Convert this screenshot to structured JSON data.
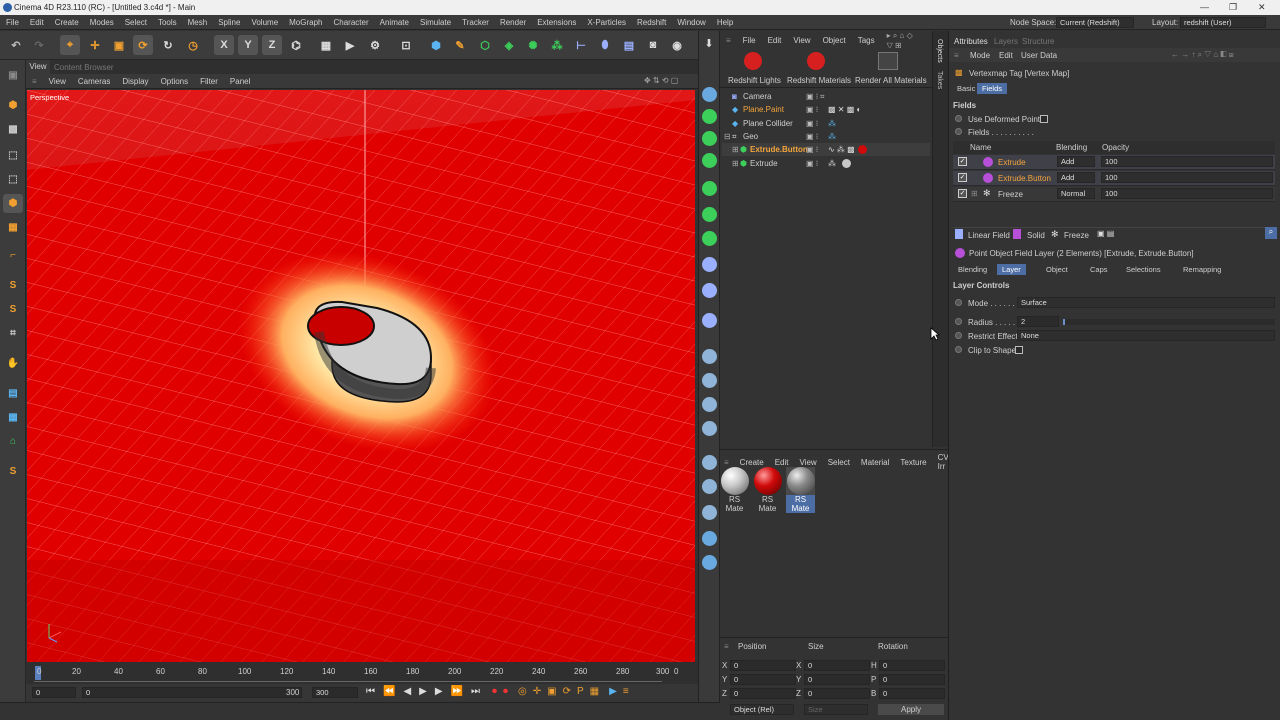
{
  "window": {
    "title": "Cinema 4D R23.110 (RC) - [Untitled 3.c4d *] - Main"
  },
  "menu": [
    "File",
    "Edit",
    "Create",
    "Modes",
    "Select",
    "Tools",
    "Mesh",
    "Spline",
    "Volume",
    "MoGraph",
    "Character",
    "Animate",
    "Simulate",
    "Tracker",
    "Render",
    "Extensions",
    "X-Particles",
    "Redshift",
    "Window",
    "Help"
  ],
  "node_space": {
    "label": "Node Space:",
    "value": "Current (Redshift)"
  },
  "layout": {
    "label": "Layout:",
    "value": "redshift (User)"
  },
  "viewport": {
    "tabs": [
      "View",
      "Content Browser"
    ],
    "menu": [
      "View",
      "Cameras",
      "Display",
      "Options",
      "Filter",
      "Panel"
    ],
    "label": "Perspective"
  },
  "timeline": {
    "ticks": [
      "0",
      "20",
      "40",
      "60",
      "80",
      "100",
      "120",
      "140",
      "160",
      "180",
      "200",
      "220",
      "240",
      "260",
      "280",
      "300"
    ],
    "end_frame": "0",
    "current": "0",
    "start": "0",
    "min_field": "300",
    "max_field": "300"
  },
  "objects": {
    "menu": [
      "File",
      "Edit",
      "View",
      "Object",
      "Tags"
    ],
    "rs_buttons": [
      "Redshift Lights",
      "Redshift Materials",
      "Render All Materials"
    ],
    "items": [
      {
        "name": "Camera",
        "indent": 0,
        "highlight": false
      },
      {
        "name": "Plane.Paint",
        "indent": 0,
        "highlight": true
      },
      {
        "name": "Plane Collider",
        "indent": 0,
        "highlight": false
      },
      {
        "name": "Geo",
        "indent": 0,
        "highlight": false
      },
      {
        "name": "Extrude.Button",
        "indent": 1,
        "highlight": true
      },
      {
        "name": "Extrude",
        "indent": 1,
        "highlight": false
      }
    ],
    "side_tabs": [
      "Objects",
      "Takes"
    ]
  },
  "materials": {
    "menu": [
      "Create",
      "Edit",
      "View",
      "Select",
      "Material",
      "Texture",
      "CV-Irr"
    ],
    "items": [
      {
        "label": "RS Mate",
        "color": "#c8c8c8"
      },
      {
        "label": "RS Mate",
        "color": "#d10a0a"
      },
      {
        "label": "RS Mate",
        "color": "#8a8a8a"
      }
    ]
  },
  "coordinates": {
    "headers": [
      "Position",
      "Size",
      "Rotation"
    ],
    "rows": [
      {
        "axis": "X",
        "pos": "0",
        "size_axis": "X",
        "size": "0",
        "rot_axis": "H",
        "rot": "0"
      },
      {
        "axis": "Y",
        "pos": "0",
        "size_axis": "Y",
        "size": "0",
        "rot_axis": "P",
        "rot": "0"
      },
      {
        "axis": "Z",
        "pos": "0",
        "size_axis": "Z",
        "size": "0",
        "rot_axis": "B",
        "rot": "0"
      }
    ],
    "mode": "Object (Rel)",
    "size_mode": "Size",
    "apply": "Apply"
  },
  "attributes": {
    "tabs": [
      "Attributes",
      "Layers",
      "Structure"
    ],
    "menu": [
      "Mode",
      "Edit",
      "User Data"
    ],
    "tag_title": "Vertexmap Tag [Vertex Map]",
    "subtabs": [
      "Basic",
      "Fields"
    ],
    "section": "Fields",
    "use_deformed": "Use Deformed Points",
    "fields_label": "Fields . . . . . . . . . .",
    "columns": [
      "Name",
      "Blending",
      "Opacity"
    ],
    "field_rows": [
      {
        "name": "Extrude",
        "blending": "Add",
        "opacity": "100"
      },
      {
        "name": "Extrude.Button",
        "blending": "Add",
        "opacity": "100"
      },
      {
        "name": "Freeze",
        "blending": "Normal",
        "opacity": "100"
      }
    ],
    "add_buttons": [
      "Linear Field",
      "Solid",
      "Freeze"
    ],
    "layer_title": "Point Object Field Layer (2 Elements) [Extrude, Extrude.Button]",
    "layer_tabs": [
      "Blending",
      "Layer",
      "Object",
      "Caps",
      "Selections",
      "Remapping"
    ],
    "layer_section": "Layer Controls",
    "mode_label": "Mode . . . . . . .",
    "mode_value": "Surface",
    "radius_label": "Radius . . . . . .",
    "radius_value": "2",
    "restrict_label": "Restrict Effect",
    "restrict_value": "None",
    "clip_label": "Clip to Shape"
  }
}
